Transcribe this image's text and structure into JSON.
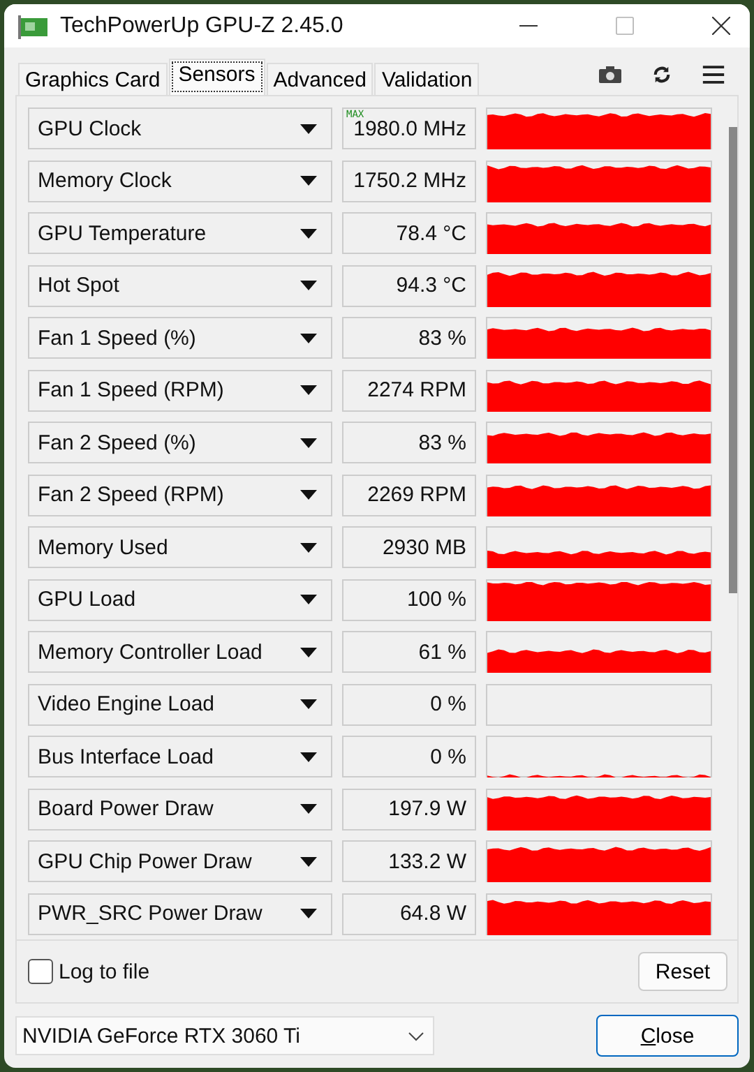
{
  "window": {
    "title": "TechPowerUp GPU-Z 2.45.0"
  },
  "tabs": [
    {
      "label": "Graphics Card",
      "selected": false
    },
    {
      "label": "Sensors",
      "selected": true
    },
    {
      "label": "Advanced",
      "selected": false
    },
    {
      "label": "Validation",
      "selected": false
    }
  ],
  "sensors": [
    {
      "name": "GPU Clock",
      "value": "1980.0 MHz",
      "badge": "MAX"
    },
    {
      "name": "Memory Clock",
      "value": "1750.2 MHz"
    },
    {
      "name": "GPU Temperature",
      "value": "78.4 °C"
    },
    {
      "name": "Hot Spot",
      "value": "94.3 °C"
    },
    {
      "name": "Fan 1 Speed (%)",
      "value": "83 %"
    },
    {
      "name": "Fan 1 Speed (RPM)",
      "value": "2274 RPM"
    },
    {
      "name": "Fan 2 Speed (%)",
      "value": "83 %"
    },
    {
      "name": "Fan 2 Speed (RPM)",
      "value": "2269 RPM"
    },
    {
      "name": "Memory Used",
      "value": "2930 MB"
    },
    {
      "name": "GPU Load",
      "value": "100 %"
    },
    {
      "name": "Memory Controller Load",
      "value": "61 %"
    },
    {
      "name": "Video Engine Load",
      "value": "0 %"
    },
    {
      "name": "Bus Interface Load",
      "value": "0 %"
    },
    {
      "name": "Board Power Draw",
      "value": "197.9 W"
    },
    {
      "name": "GPU Chip Power Draw",
      "value": "133.2 W"
    },
    {
      "name": "PWR_SRC Power Draw",
      "value": "64.8 W"
    }
  ],
  "log_to_file": {
    "label": "Log to file",
    "checked": false
  },
  "reset_button": "Reset",
  "gpu_select": {
    "value": "NVIDIA GeForce RTX 3060 Ti"
  },
  "close_button": {
    "label": "Close"
  }
}
